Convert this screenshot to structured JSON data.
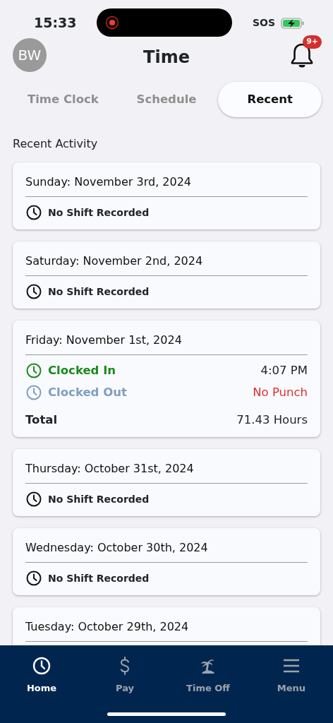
{
  "status_bar": {
    "time": "15:33",
    "carrier": "SOS",
    "recording": true,
    "charging": true
  },
  "header": {
    "avatar": "BW",
    "title": "Time",
    "notification_badge": "9+"
  },
  "tabs": [
    {
      "label": "Time Clock",
      "selected": false
    },
    {
      "label": "Schedule",
      "selected": false
    },
    {
      "label": "Recent",
      "selected": true
    }
  ],
  "section_title": "Recent Activity",
  "days": [
    {
      "kind": "no_shift",
      "date": "Sunday: November 3rd, 2024",
      "status": "No Shift Recorded"
    },
    {
      "kind": "no_shift",
      "date": "Saturday: November 2nd, 2024",
      "status": "No Shift Recorded"
    },
    {
      "kind": "shift",
      "date": "Friday: November 1st, 2024",
      "punches": [
        {
          "kind": "in",
          "label": "Clocked In",
          "value": "4:07 PM",
          "missing": false
        },
        {
          "kind": "out",
          "label": "Clocked Out",
          "value": "No Punch",
          "missing": true
        }
      ],
      "total_label": "Total",
      "total_value": "71.43 Hours"
    },
    {
      "kind": "no_shift",
      "date": "Thursday: October 31st, 2024",
      "status": "No Shift Recorded"
    },
    {
      "kind": "no_shift",
      "date": "Wednesday: October 30th, 2024",
      "status": "No Shift Recorded"
    },
    {
      "kind": "no_shift",
      "date": "Tuesday: October 29th, 2024"
    }
  ],
  "bottom_nav": [
    {
      "kind": "home",
      "label": "Home",
      "selected": true
    },
    {
      "kind": "pay",
      "label": "Pay",
      "selected": false
    },
    {
      "kind": "time_off",
      "label": "Time Off",
      "selected": false
    },
    {
      "kind": "menu",
      "label": "Menu",
      "selected": false
    }
  ]
}
